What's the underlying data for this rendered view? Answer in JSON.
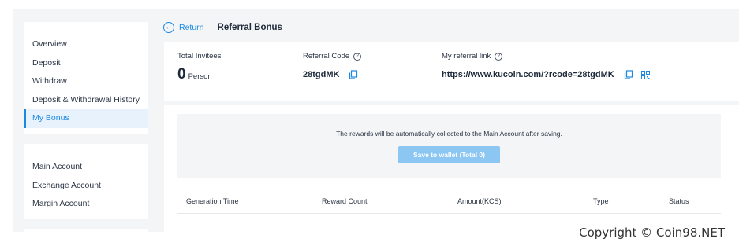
{
  "sidebar": {
    "group1": [
      {
        "label": "Overview",
        "active": false
      },
      {
        "label": "Deposit",
        "active": false
      },
      {
        "label": "Withdraw",
        "active": false
      },
      {
        "label": "Deposit & Withdrawal History",
        "active": false
      },
      {
        "label": "My Bonus",
        "active": true
      }
    ],
    "group2": [
      {
        "label": "Main Account"
      },
      {
        "label": "Exchange Account"
      },
      {
        "label": "Margin Account"
      }
    ]
  },
  "header": {
    "return_label": "Return",
    "title": "Referral Bonus"
  },
  "stats": {
    "invitees_label": "Total Invitees",
    "invitees_count": "0",
    "invitees_unit": "Person",
    "code_label": "Referral Code",
    "code_value": "28tgdMK",
    "link_label": "My referral link",
    "link_value": "https://www.kucoin.com/?rcode=28tgdMK"
  },
  "notice": {
    "text": "The rewards will be automatically collected to the Main Account after saving.",
    "button_label": "Save to wallet (Total 0)"
  },
  "table": {
    "columns": [
      "Generation Time",
      "Reward Count",
      "Amount(KCS)",
      "Type",
      "Status"
    ]
  },
  "watermark": "Copyright © Coin98.NET",
  "colors": {
    "accent": "#1b88e3",
    "button_disabled": "#8cc6f2",
    "background": "#f4f5f7"
  },
  "icons": [
    "back-circle-icon",
    "help-icon",
    "copy-icon",
    "qr-code-icon"
  ]
}
